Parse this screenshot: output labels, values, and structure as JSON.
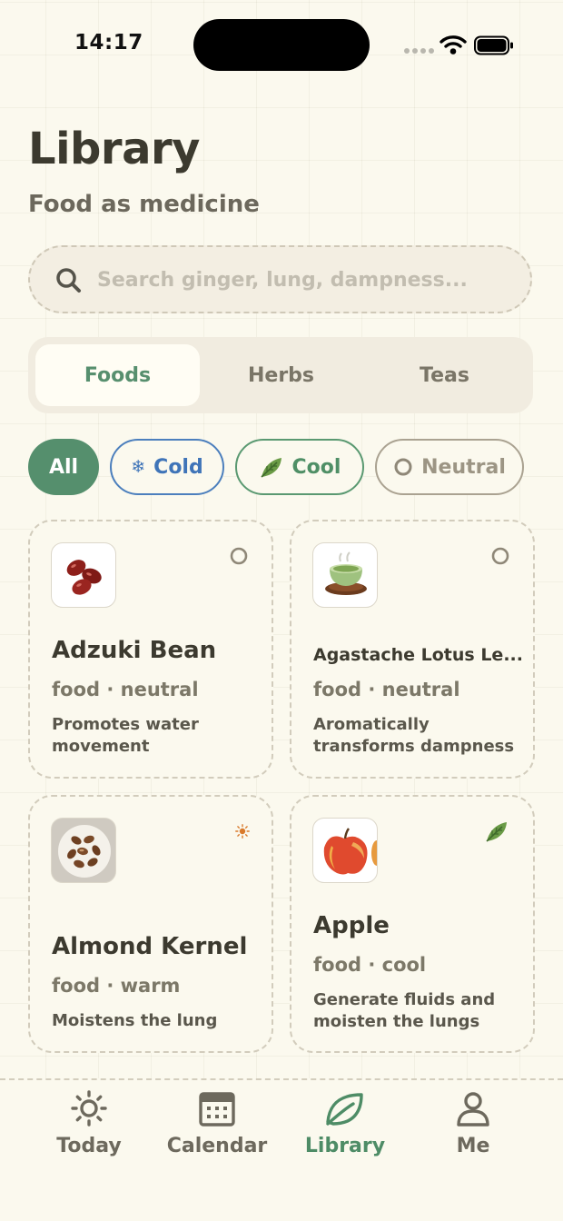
{
  "status_bar": {
    "time": "14:17"
  },
  "header": {
    "title": "Library",
    "subtitle": "Food as medicine"
  },
  "search": {
    "placeholder": "Search ginger, lung, dampness...",
    "value": ""
  },
  "segments": [
    {
      "label": "Foods",
      "active": true
    },
    {
      "label": "Herbs",
      "active": false
    },
    {
      "label": "Teas",
      "active": false
    }
  ],
  "filters": [
    {
      "label": "All",
      "active": true
    },
    {
      "label": "Cold",
      "icon": "snowflake-icon"
    },
    {
      "label": "Cool",
      "icon": "leaf-icon"
    },
    {
      "label": "Neutral",
      "icon": "circle-icon"
    }
  ],
  "cards": [
    {
      "name": "Adzuki Bean",
      "meta": "food · neutral",
      "description": "Promotes water movement",
      "nature_icon": "neutral-circle-icon",
      "image": "adzuki-beans"
    },
    {
      "name": "Agastache Lotus Le...",
      "meta": "food · neutral",
      "description": "Aromatically transforms dampness",
      "nature_icon": "neutral-circle-icon",
      "image": "green-tea-cup"
    },
    {
      "name": "Almond Kernel",
      "meta": "food · warm",
      "description": "Moistens the lung",
      "nature_icon": "sun-icon",
      "image": "almonds-bowl"
    },
    {
      "name": "Apple",
      "meta": "food · cool",
      "description": "Generate fluids and moisten the lungs",
      "nature_icon": "leaf-icon",
      "image": "apple"
    }
  ],
  "tabbar": [
    {
      "label": "Today",
      "icon": "sun-icon"
    },
    {
      "label": "Calendar",
      "icon": "calendar-icon"
    },
    {
      "label": "Library",
      "icon": "leaf-icon",
      "active": true
    },
    {
      "label": "Me",
      "icon": "person-icon"
    }
  ],
  "colors": {
    "background": "#fbf9ee",
    "accent_green": "#558f6d",
    "cold_blue": "#3f74b8",
    "warm_orange": "#d97a2b",
    "neutral_gray": "#9c9584"
  }
}
